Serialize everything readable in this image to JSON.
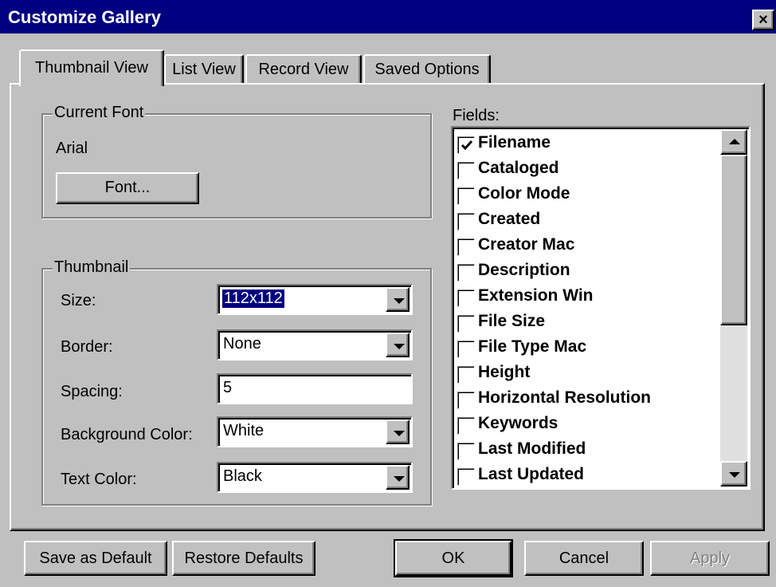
{
  "window": {
    "title": "Customize Gallery",
    "close_glyph": "×"
  },
  "tabs": [
    {
      "label": "Thumbnail View",
      "active": true
    },
    {
      "label": "List View",
      "active": false
    },
    {
      "label": "Record View",
      "active": false
    },
    {
      "label": "Saved Options",
      "active": false
    }
  ],
  "font_group": {
    "label": "Current Font",
    "current_font": "Arial",
    "font_button": "Font..."
  },
  "thumbnail_group": {
    "label": "Thumbnail",
    "size_label": "Size:",
    "size_value": "112x112",
    "border_label": "Border:",
    "border_value": "None",
    "spacing_label": "Spacing:",
    "spacing_value": "5",
    "background_label": "Background Color:",
    "background_value": "White",
    "text_color_label": "Text Color:",
    "text_color_value": "Black"
  },
  "fields": {
    "label": "Fields:",
    "items": [
      {
        "label": "Filename",
        "checked": true
      },
      {
        "label": "Cataloged",
        "checked": false
      },
      {
        "label": "Color Mode",
        "checked": false
      },
      {
        "label": "Created",
        "checked": false
      },
      {
        "label": "Creator Mac",
        "checked": false
      },
      {
        "label": "Description",
        "checked": false
      },
      {
        "label": "Extension Win",
        "checked": false
      },
      {
        "label": "File Size",
        "checked": false
      },
      {
        "label": "File Type Mac",
        "checked": false
      },
      {
        "label": "Height",
        "checked": false
      },
      {
        "label": "Horizontal Resolution",
        "checked": false
      },
      {
        "label": "Keywords",
        "checked": false
      },
      {
        "label": "Last Modified",
        "checked": false
      },
      {
        "label": "Last Updated",
        "checked": false
      }
    ]
  },
  "buttons": {
    "save_default": "Save as Default",
    "restore_defaults": "Restore Defaults",
    "ok": "OK",
    "cancel": "Cancel",
    "apply": "Apply"
  },
  "colors": {
    "title_bar": "#000080",
    "face": "#c0c0c0",
    "selection": "#000080"
  }
}
